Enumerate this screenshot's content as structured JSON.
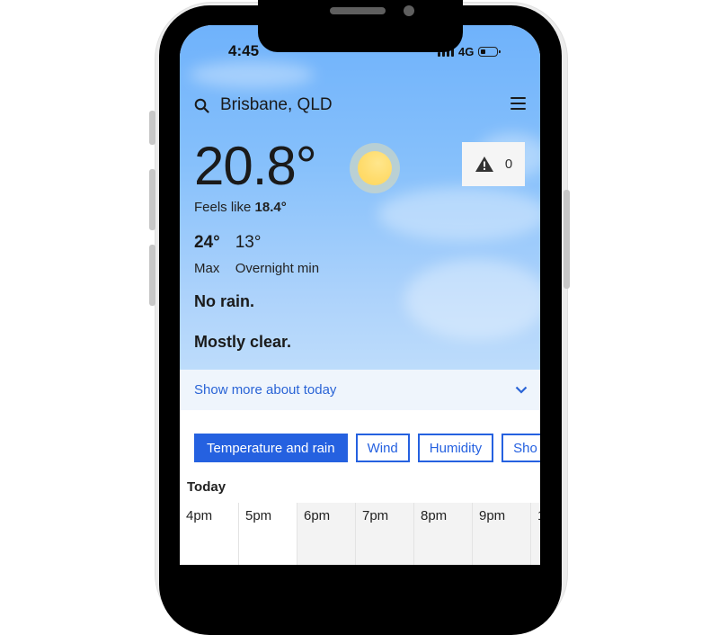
{
  "status_bar": {
    "time": "4:45",
    "network": "4G",
    "battery_level_percent": 20
  },
  "header": {
    "search_icon": "search-icon",
    "location": "Brisbane, QLD",
    "menu_icon": "hamburger-menu-icon"
  },
  "current": {
    "temperature": "20.8°",
    "condition_icon": "sunny-icon",
    "feels_like_label": "Feels like",
    "feels_like_value": "18.4°",
    "warnings": {
      "icon": "warning-triangle-icon",
      "count": "0"
    },
    "max_value": "24°",
    "max_label": "Max",
    "min_value": "13°",
    "min_label": "Overnight min",
    "rain_summary": "No rain.",
    "description": "Mostly clear."
  },
  "show_more": {
    "label": "Show more about today",
    "icon": "chevron-down-icon"
  },
  "tabs": [
    {
      "label": "Temperature and rain",
      "active": true
    },
    {
      "label": "Wind",
      "active": false
    },
    {
      "label": "Humidity",
      "active": false
    },
    {
      "label": "Sho",
      "active": false
    }
  ],
  "forecast": {
    "day_label": "Today",
    "hours": [
      "4pm",
      "5pm",
      "6pm",
      "7pm",
      "8pm",
      "9pm",
      "1"
    ]
  },
  "colors": {
    "accent": "#2561e0",
    "sky_top": "#6fb2fb",
    "sky_bottom": "#bddcfb",
    "show_more_bg": "#eff5fc"
  }
}
